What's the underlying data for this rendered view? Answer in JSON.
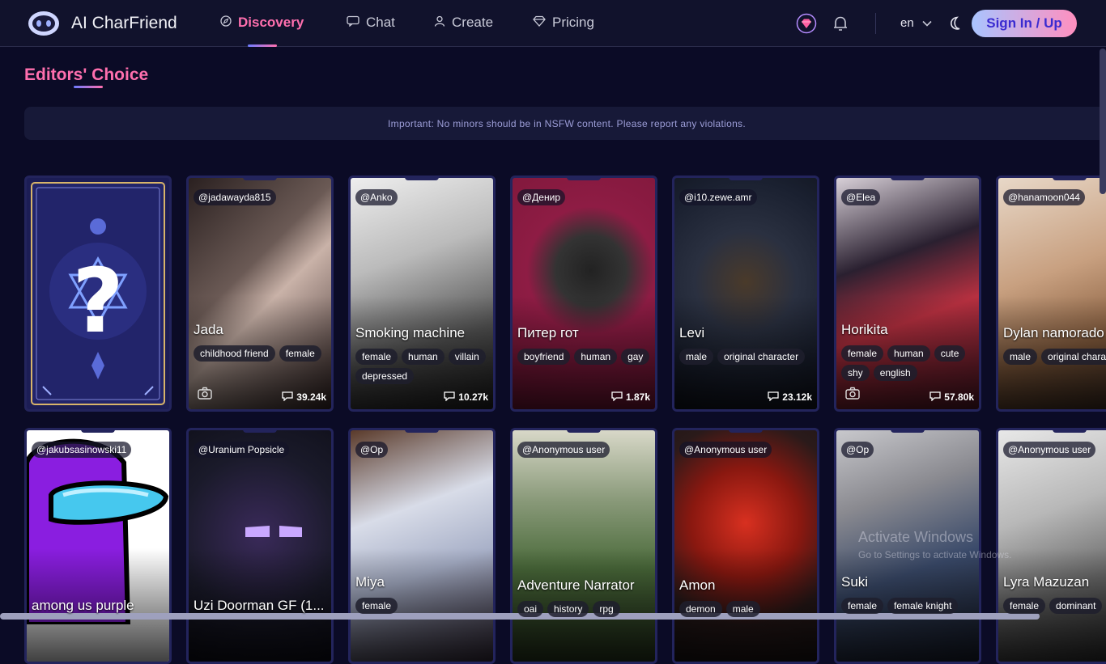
{
  "app": {
    "title": "AI CharFriend"
  },
  "nav": [
    {
      "label": "Discovery",
      "icon": "compass-icon",
      "active": true
    },
    {
      "label": "Chat",
      "icon": "chat-bubble-icon",
      "active": false
    },
    {
      "label": "Create",
      "icon": "user-icon",
      "active": false
    },
    {
      "label": "Pricing",
      "icon": "diamond-icon",
      "active": false
    }
  ],
  "header": {
    "lang": "en",
    "signin_label": "Sign In / Up"
  },
  "section": {
    "title": "Editors' Choice"
  },
  "notice": "Important: No minors should be in NSFW content. Please report any violations.",
  "cards": [
    {
      "creator": "@jadawayda815",
      "name": "Jada",
      "tags": [
        "childhood friend",
        "female"
      ],
      "chats": "39.24k",
      "has_camera": true
    },
    {
      "creator": "@Anko",
      "name": "Smoking machine",
      "tags": [
        "female",
        "human",
        "villain",
        "depressed"
      ],
      "chats": "10.27k",
      "has_camera": false
    },
    {
      "creator": "@Денир",
      "name": "Питер гот",
      "tags": [
        "boyfriend",
        "human",
        "gay"
      ],
      "chats": "1.87k",
      "has_camera": false
    },
    {
      "creator": "@i10.zewe.amr",
      "name": "Levi",
      "tags": [
        "male",
        "original character"
      ],
      "chats": "23.12k",
      "has_camera": false
    },
    {
      "creator": "@Elea",
      "name": "Horikita",
      "tags": [
        "female",
        "human",
        "cute",
        "shy",
        "english"
      ],
      "chats": "57.80k",
      "has_camera": true
    },
    {
      "creator": "@hanamoon044",
      "name": "Dylan namorado",
      "tags": [
        "male",
        "original character"
      ],
      "chats": "",
      "has_camera": false
    },
    {
      "creator": "@jakubsasinowski11",
      "name": "among us purple",
      "tags": [],
      "chats": "",
      "has_camera": false
    },
    {
      "creator": "@Uranium Popsicle",
      "name": "Uzi Doorman GF (1...",
      "tags": [],
      "chats": "",
      "has_camera": false
    },
    {
      "creator": "@Op",
      "name": "Miya",
      "tags": [
        "female"
      ],
      "chats": "",
      "has_camera": false
    },
    {
      "creator": "@Anonymous user",
      "name": "Adventure Narrator",
      "tags": [
        "oai",
        "history",
        "rpg"
      ],
      "chats": "",
      "has_camera": false
    },
    {
      "creator": "@Anonymous user",
      "name": "Amon",
      "tags": [
        "demon",
        "male"
      ],
      "chats": "",
      "has_camera": false
    },
    {
      "creator": "@Op",
      "name": "Suki",
      "tags": [
        "female",
        "female knight"
      ],
      "chats": "",
      "has_camera": false
    },
    {
      "creator": "@Anonymous user",
      "name": "Lyra Mazuzan",
      "tags": [
        "female",
        "dominant"
      ],
      "chats": "",
      "has_camera": false
    }
  ],
  "watermark": {
    "line1": "Activate Windows",
    "line2": "Go to Settings to activate Windows."
  },
  "colors": {
    "accent": "#ff6fae",
    "card_border": "#23245c",
    "background": "#0b0b26"
  }
}
